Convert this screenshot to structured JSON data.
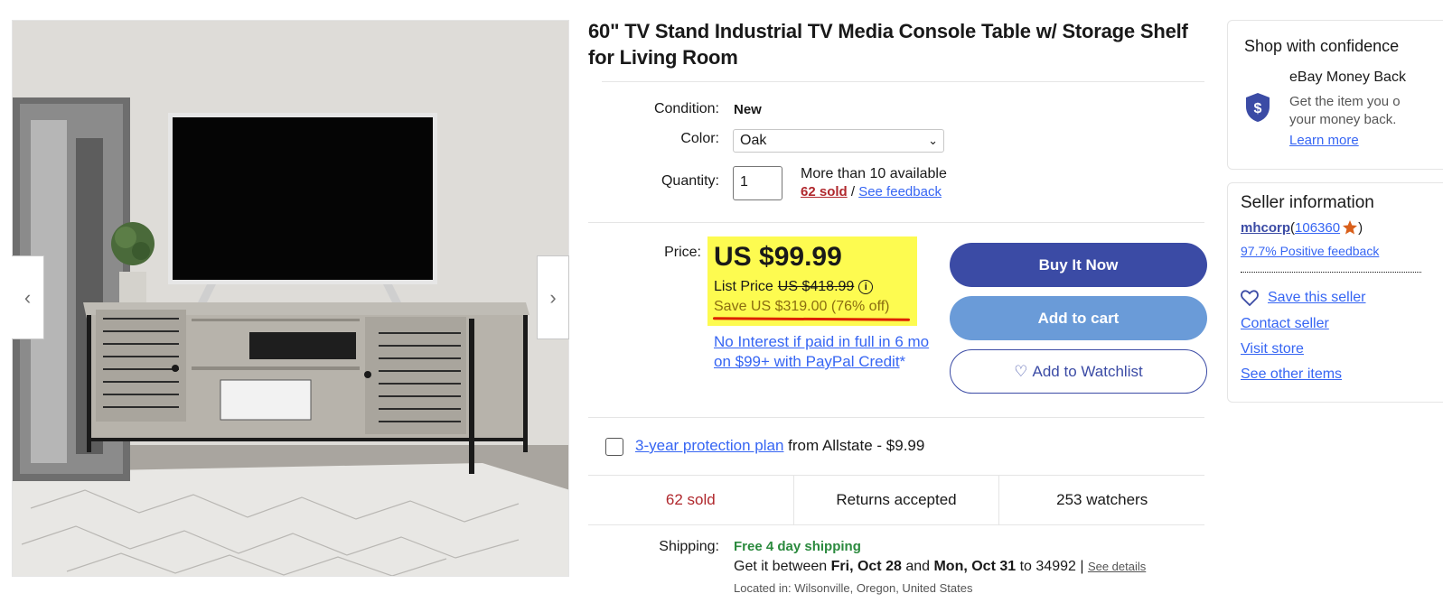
{
  "gallery": {
    "prev_arrow": "‹",
    "next_arrow": "›"
  },
  "item": {
    "title": "60\" TV Stand Industrial TV Media Console Table w/ Storage Shelf for Living Room"
  },
  "details": {
    "condition_label": "Condition:",
    "condition_value": "New",
    "color_label": "Color:",
    "color_value": "Oak",
    "quantity_label": "Quantity:",
    "quantity_value": "1",
    "availability": "More than 10 available",
    "sold_link": "62 sold",
    "separator": " / ",
    "feedback_link": "See feedback"
  },
  "pricing": {
    "price_label": "Price:",
    "price": "US $99.99",
    "list_price_label": "List Price",
    "list_price": "US $418.99",
    "info_icon": "i",
    "savings": "Save US $319.00 (76% off)",
    "paypal_link": "No Interest if paid in full in 6 mo on $99+ with PayPal Credit",
    "paypal_asterisk": "*"
  },
  "actions": {
    "buy_now": "Buy It Now",
    "add_to_cart": "Add to cart",
    "watchlist_icon": "♡",
    "add_to_watchlist": "Add to Watchlist"
  },
  "protection": {
    "link": "3-year protection plan",
    "suffix": " from Allstate - $9.99"
  },
  "stats": {
    "sold": "62 sold",
    "returns": "Returns accepted",
    "watchers": "253 watchers"
  },
  "shipping": {
    "label": "Shipping:",
    "free": "Free 4 day shipping",
    "between_prefix": "Get it between ",
    "date_start": "Fri, Oct 28",
    "and": " and ",
    "date_end": "Mon, Oct 31",
    "to_zip": " to 34992 | ",
    "see_details": "See details",
    "located": "Located in: Wilsonville, Oregon, United States"
  },
  "confidence": {
    "title": "Shop with confidence",
    "money_back_title": "eBay Money Back",
    "money_back_desc_1": "Get the item you o",
    "money_back_desc_2": "your money back.",
    "learn_more": "Learn more",
    "shield_icon": "shield-dollar-icon"
  },
  "seller": {
    "title": "Seller information",
    "name": "mhcorp",
    "open_paren": " (",
    "score": "106360",
    "close_paren": ")",
    "positive": "97.7% Positive feedback",
    "save_seller": "Save this seller",
    "contact": "Contact seller",
    "visit_store": "Visit store",
    "other_items": "See other items"
  },
  "colors": {
    "buy_now_bg": "#3b4ba5",
    "add_to_cart_bg": "#6a9bd8",
    "price_highlight": "#fdfb50",
    "sold_red": "#b0282d",
    "link_blue": "#3665f3",
    "free_shipping_green": "#2b8a3e"
  }
}
